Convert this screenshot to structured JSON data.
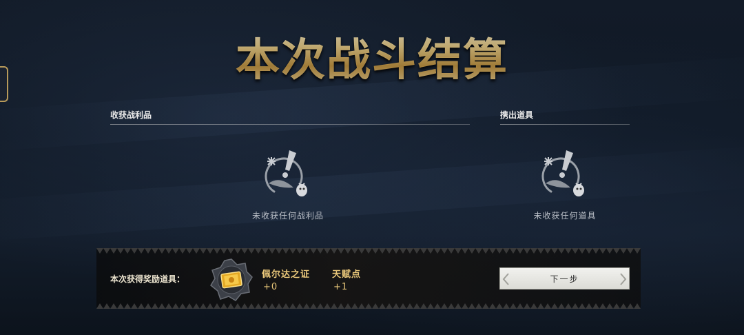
{
  "title": "本次战斗结算",
  "loot_section": {
    "heading": "收获战利品",
    "empty_text": "未收获任何战利品",
    "empty_icon": "empty-bird-alert-icon"
  },
  "items_section": {
    "heading": "携出道具",
    "empty_text": "未收获任何道具",
    "empty_icon": "empty-bird-alert-icon"
  },
  "rewards": {
    "label": "本次获得奖励道具：",
    "badge_icon": "gold-card-badge-icon",
    "items": [
      {
        "name": "佩尔达之证",
        "amount": "+0"
      },
      {
        "name": "天赋点",
        "amount": "+1"
      }
    ]
  },
  "next_button": {
    "label": "下一步"
  },
  "colors": {
    "gold": "#e9c77a",
    "title_gold": "#f0d38c",
    "background": "#121b28",
    "button": "#e8e8e4"
  }
}
